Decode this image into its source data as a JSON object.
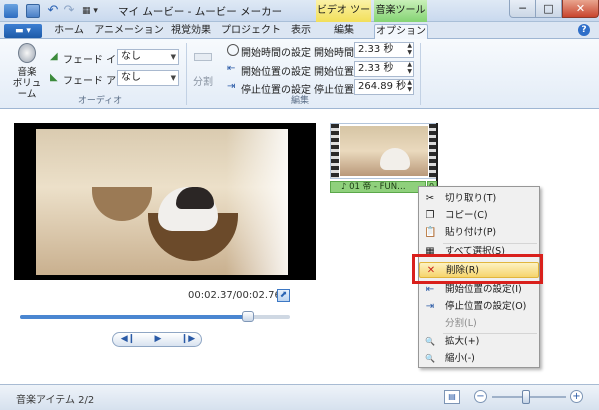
{
  "window": {
    "title": "マイ ムービー - ムービー メーカー",
    "context_tabs": {
      "video_tools": "ビデオ ツール",
      "music_tools": "音楽ツール"
    },
    "controls": {
      "minimize": "─",
      "maximize": "□",
      "close": "✕"
    }
  },
  "quick_access": {
    "undo": "↶",
    "redo": "↷",
    "customize": "▦ ▾"
  },
  "tabs": [
    {
      "label": "ホーム"
    },
    {
      "label": "アニメーション"
    },
    {
      "label": "視覚効果"
    },
    {
      "label": "プロジェクト"
    },
    {
      "label": "表示"
    },
    {
      "label": "編集"
    },
    {
      "label": "オプション",
      "selected": true
    }
  ],
  "ribbon": {
    "audio_group": {
      "label": "オーディオ",
      "volume_button": "音楽\nボリューム",
      "fade_in_label": "フェード イン:",
      "fade_in_value": "なし",
      "fade_out_label": "フェード アウト:",
      "fade_out_value": "なし"
    },
    "edit_group": {
      "label": "編集",
      "split_button": "分割",
      "set_start_time": "開始時間の設定",
      "set_start_point": "開始位置の設定",
      "set_end_point": "停止位置の設定",
      "start_time_label": "開始時間:",
      "start_time_value": "2.33 秒",
      "start_point_label": "開始位置:",
      "start_point_value": "2.33 秒",
      "end_point_label": "停止位置:",
      "end_point_value": "264.89 秒"
    }
  },
  "preview": {
    "timecode": "00:02.37/00:02.76",
    "seek_progress": 0.85,
    "fullscreen_icon": "⬈",
    "transport": {
      "prev": "◀❙",
      "play": "▶",
      "next": "❙▶"
    }
  },
  "storyboard": {
    "audio_item": "♪ 01 帝 - FUN…",
    "audio_item_overflow": "0"
  },
  "context_menu": {
    "items": [
      {
        "label": "切り取り(T)",
        "icon": "✂"
      },
      {
        "label": "コピー(C)",
        "icon": "❐"
      },
      {
        "label": "貼り付け(P)",
        "icon": "📋"
      },
      {
        "label": "すべて選択(S)",
        "icon": "▦"
      },
      {
        "label": "削除(R)",
        "icon": "✕",
        "highlighted": true
      },
      {
        "label": "開始位置の設定(I)",
        "icon": "⇤"
      },
      {
        "label": "停止位置の設定(O)",
        "icon": "⇥"
      },
      {
        "label": "分割(L)",
        "icon": "",
        "disabled": true
      },
      {
        "label": "拡大(+)",
        "icon": "🔍"
      },
      {
        "label": "縮小(-)",
        "icon": "🔍"
      }
    ]
  },
  "statusbar": {
    "text": "音楽アイテム 2/2",
    "zoom_level": 0.45
  },
  "colors": {
    "accent": "#2f6fc9",
    "highlight_box": "#d9201c",
    "menu_hover": "#f6d46c",
    "audio_bar": "#8fd07c"
  }
}
